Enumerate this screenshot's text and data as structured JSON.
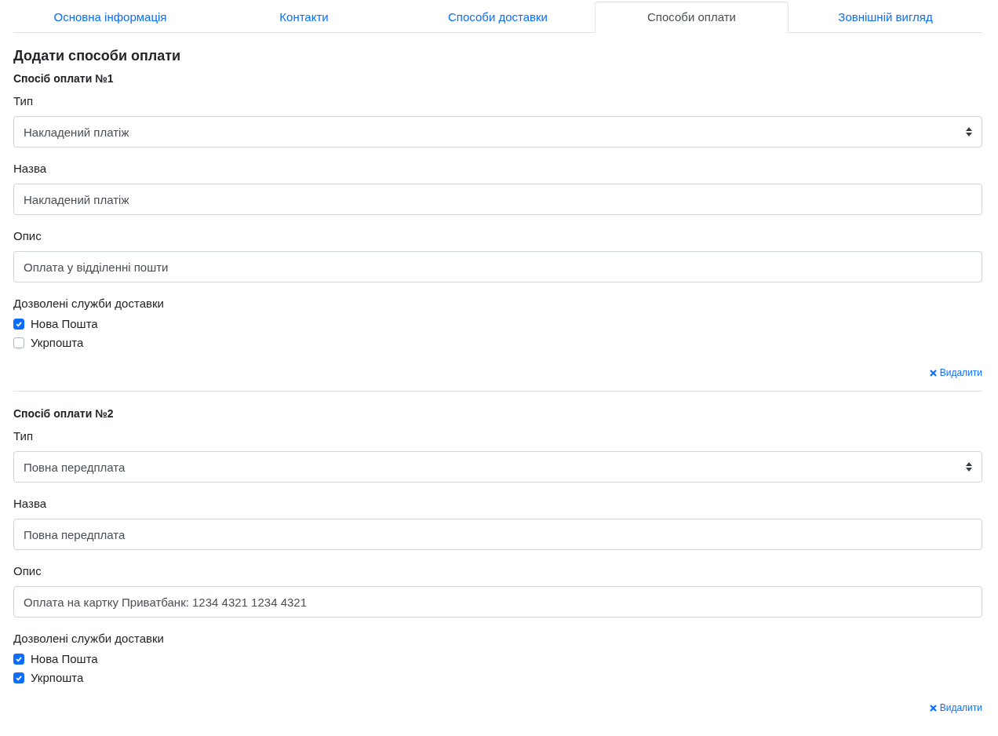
{
  "tabs": [
    {
      "label": "Основна інформація",
      "selected": false
    },
    {
      "label": "Контакти",
      "selected": false
    },
    {
      "label": "Способи доставки",
      "selected": false
    },
    {
      "label": "Способи оплати",
      "selected": true
    },
    {
      "label": "Зовнішній вигляд",
      "selected": false
    }
  ],
  "heading": "Додати способи оплати",
  "methods": [
    {
      "title": "Спосіб оплати №1",
      "type_label": "Тип",
      "type_value": "Накладений платіж",
      "name_label": "Назва",
      "name_value": "Накладений платіж",
      "description_label": "Опис",
      "description_value": "Оплата у відділенні пошти",
      "services_label": "Дозволені служби доставки",
      "services": [
        {
          "label": "Нова Пошта",
          "checked": true
        },
        {
          "label": "Укрпошта",
          "checked": false
        }
      ],
      "delete_label": "Видалити"
    },
    {
      "title": "Спосіб оплати №2",
      "type_label": "Тип",
      "type_value": "Повна передплата",
      "name_label": "Назва",
      "name_value": "Повна передплата",
      "description_label": "Опис",
      "description_value": "Оплата на картку Приватбанк: 1234 4321 1234 4321",
      "services_label": "Дозволені служби доставки",
      "services": [
        {
          "label": "Нова Пошта",
          "checked": true
        },
        {
          "label": "Укрпошта",
          "checked": true
        }
      ],
      "delete_label": "Видалити"
    }
  ]
}
